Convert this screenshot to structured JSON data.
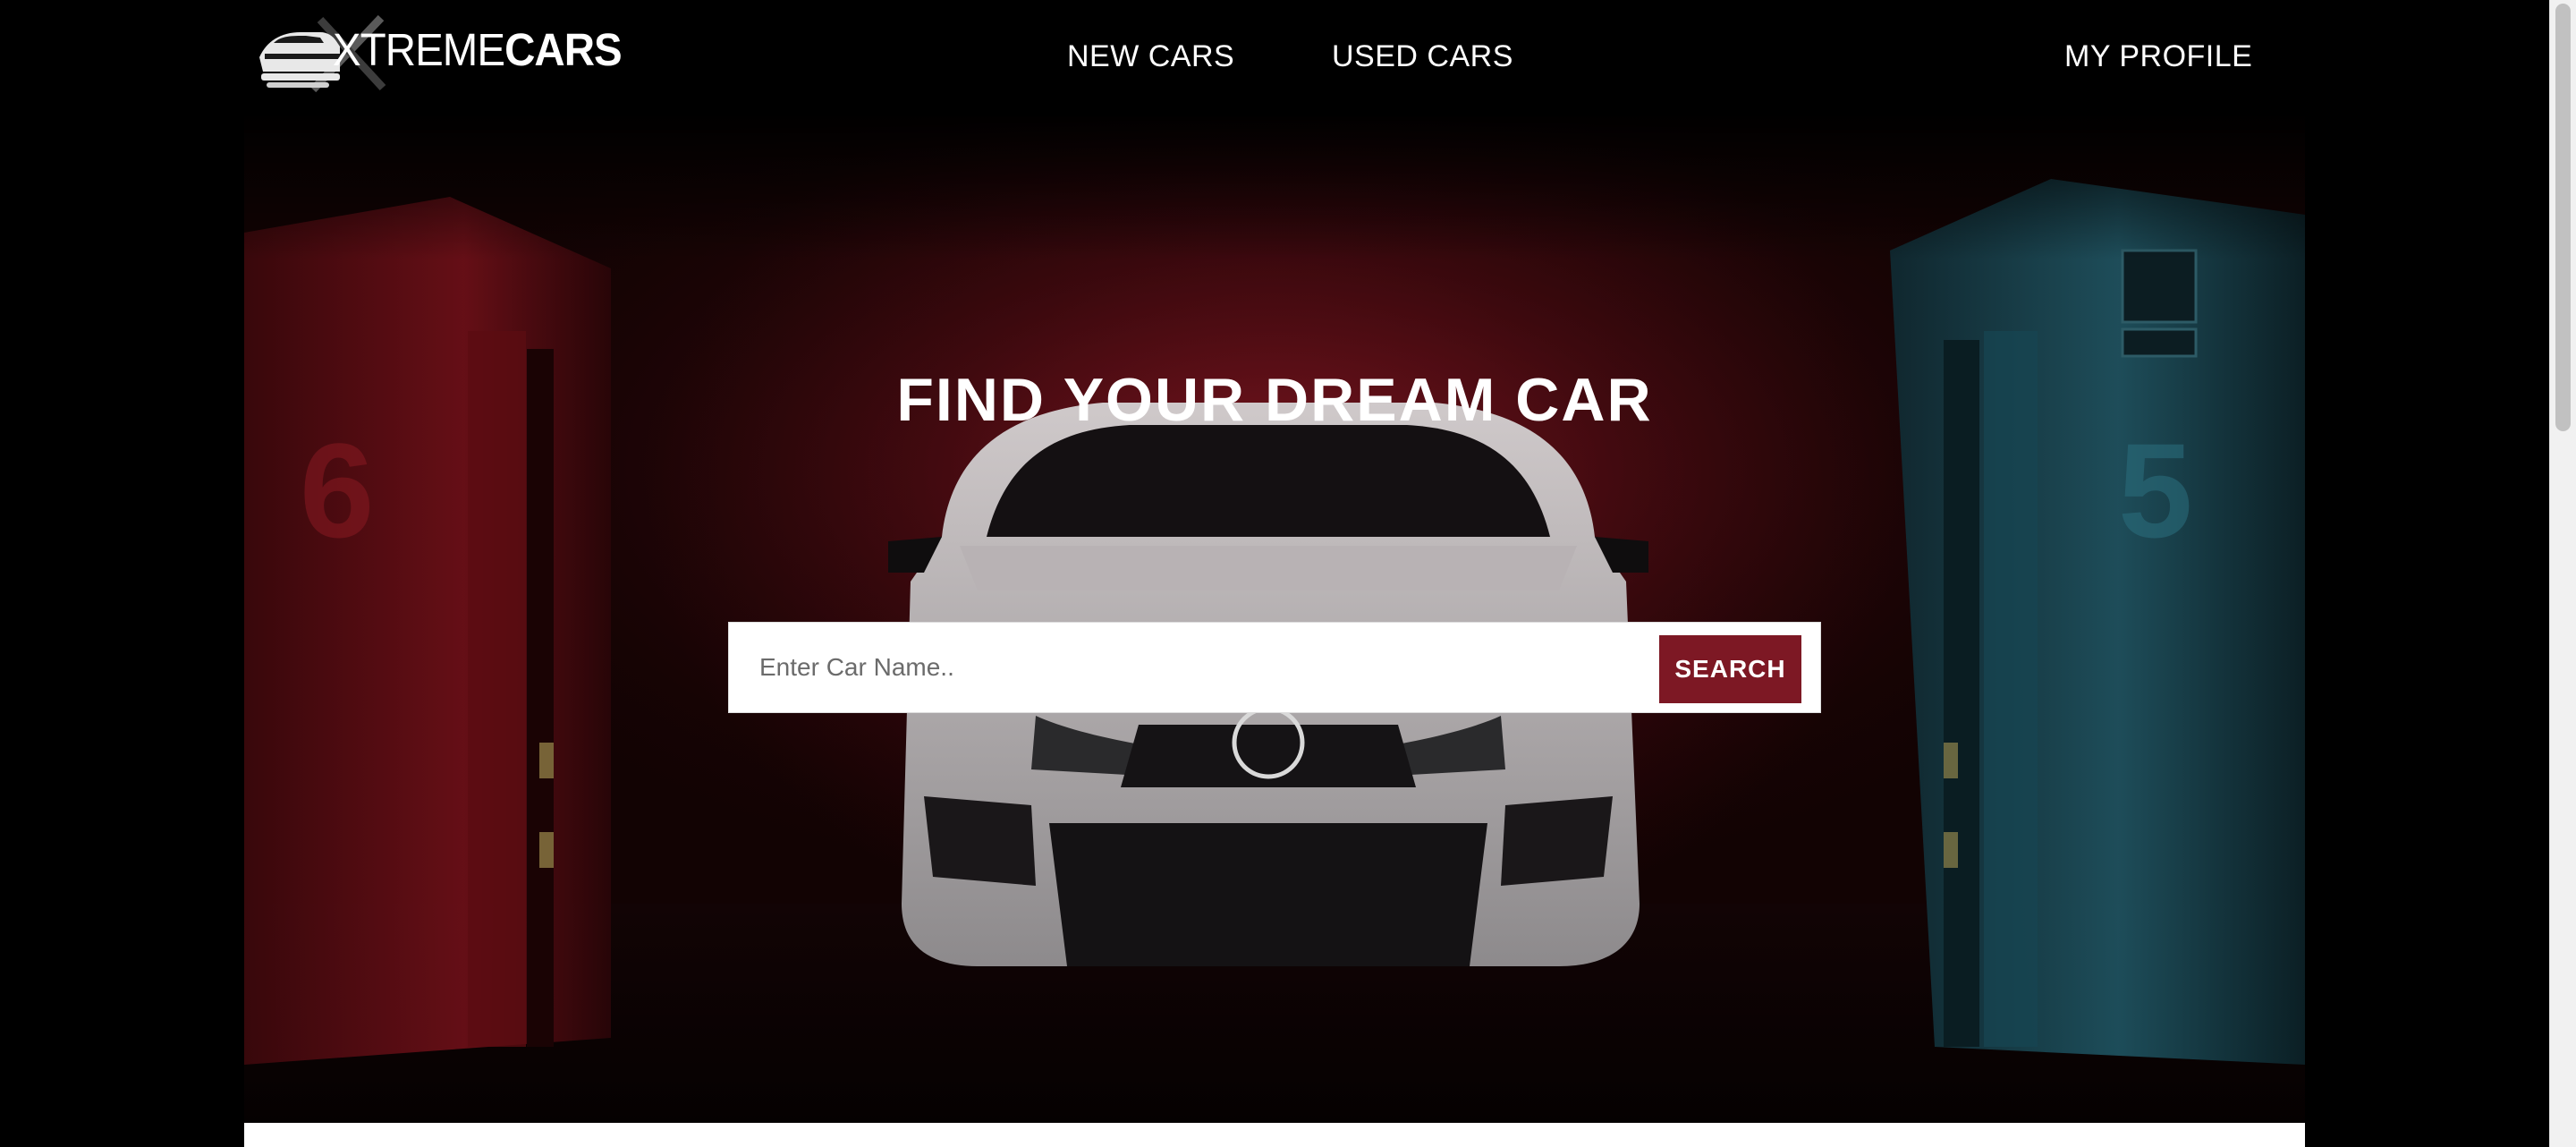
{
  "brand": {
    "logo_text_light": "XTREME",
    "logo_text_bold": "CARS"
  },
  "nav": {
    "links": [
      {
        "label": "NEW CARS"
      },
      {
        "label": "USED CARS"
      },
      {
        "label": "MY PROFILE"
      }
    ]
  },
  "hero": {
    "title": "FIND YOUR DREAM CAR"
  },
  "search": {
    "placeholder": "Enter Car Name..",
    "value": "",
    "button_label": "SEARCH"
  },
  "colors": {
    "accent": "#7d1824",
    "header_bg": "#000000",
    "hero_glow": "#5a0d14"
  }
}
